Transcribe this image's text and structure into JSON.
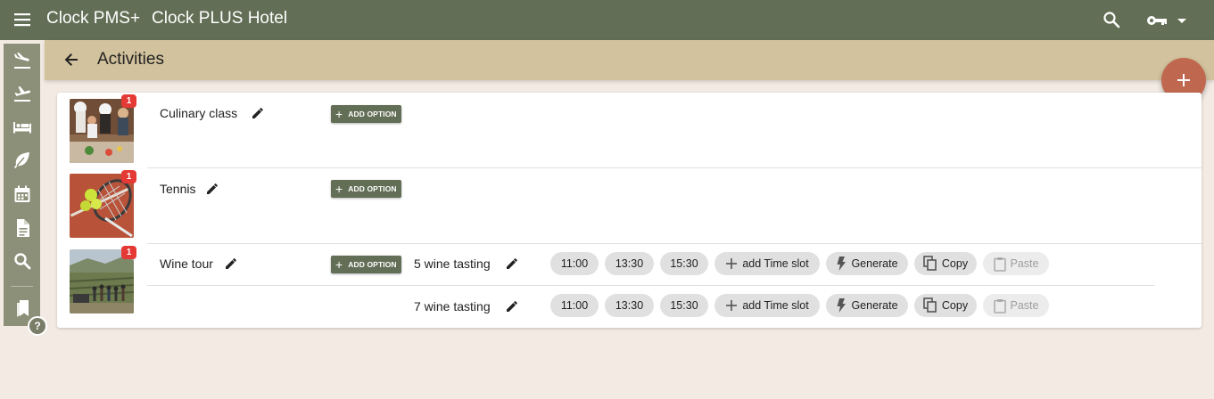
{
  "topbar": {
    "app_name": "Clock PMS+",
    "hotel_name": "Clock PLUS Hotel",
    "icons": [
      "menu-icon",
      "search-icon",
      "key-icon",
      "caret-down-icon"
    ]
  },
  "sidebar": {
    "icons": [
      "arrivals-icon",
      "departures-icon",
      "bed-icon",
      "leaf-icon",
      "calendar-icon",
      "document-icon",
      "search-icon",
      "bookmark-icon"
    ],
    "help_label": "?"
  },
  "page": {
    "title": "Activities",
    "back_icon": "arrow-left-icon",
    "fab_icon": "plus-icon"
  },
  "colors": {
    "topbar": "#626e55",
    "subheader": "#d2c29d",
    "sidebar": "#8d9079",
    "fab": "#c0684f",
    "badge": "#e53935",
    "background": "#f3ebe3"
  },
  "activities": [
    {
      "name": "Culinary class",
      "badge": "1",
      "image": "cooking class photo",
      "add_option_label": "ADD OPTION",
      "options": []
    },
    {
      "name": "Tennis",
      "badge": "1",
      "image": "tennis racket and balls photo",
      "add_option_label": "ADD OPTION",
      "options": []
    },
    {
      "name": "Wine tour",
      "badge": "1",
      "image": "vineyard group photo",
      "add_option_label": "ADD OPTION",
      "options": [
        {
          "name": "5 wine tasting",
          "time_slots": [
            "11:00",
            "13:30",
            "15:30"
          ],
          "add_slot_label": "add Time slot",
          "generate_label": "Generate",
          "copy_label": "Copy",
          "paste_label": "Paste"
        },
        {
          "name": "7 wine tasting",
          "time_slots": [
            "11:00",
            "13:30",
            "15:30"
          ],
          "add_slot_label": "add Time slot",
          "generate_label": "Generate",
          "copy_label": "Copy",
          "paste_label": "Paste"
        }
      ]
    }
  ]
}
